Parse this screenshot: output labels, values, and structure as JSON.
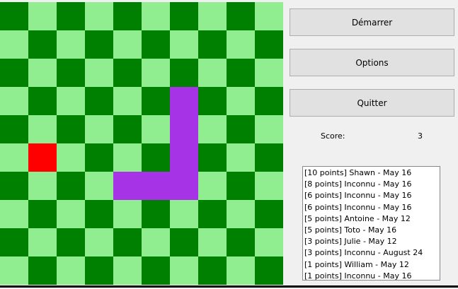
{
  "board": {
    "cols": 10,
    "rows": 10,
    "colors": {
      "dark": "#008000",
      "light": "#90ee90",
      "apple": "#ff0000",
      "snake": "#a633e6"
    },
    "apple": [
      [
        1,
        5
      ]
    ],
    "snake": [
      [
        6,
        3
      ],
      [
        6,
        4
      ],
      [
        6,
        5
      ],
      [
        6,
        6
      ],
      [
        5,
        6
      ],
      [
        4,
        6
      ]
    ]
  },
  "buttons": {
    "start": "Démarrer",
    "options": "Options",
    "quit": "Quitter"
  },
  "score": {
    "label": "Score:",
    "value": "3"
  },
  "highscores": [
    "[10 points] Shawn - May 16",
    "[8 points] Inconnu - May 16",
    "[6 points] Inconnu - May 16",
    "[6 points] Inconnu - May 16",
    "[5 points] Antoine - May 12",
    "[5 points] Toto - May 16",
    "[3 points] Julie - May 12",
    "[3 points] Inconnu - August 24",
    "[1 points] William - May 12",
    "[1 points] Inconnu - May 16"
  ]
}
